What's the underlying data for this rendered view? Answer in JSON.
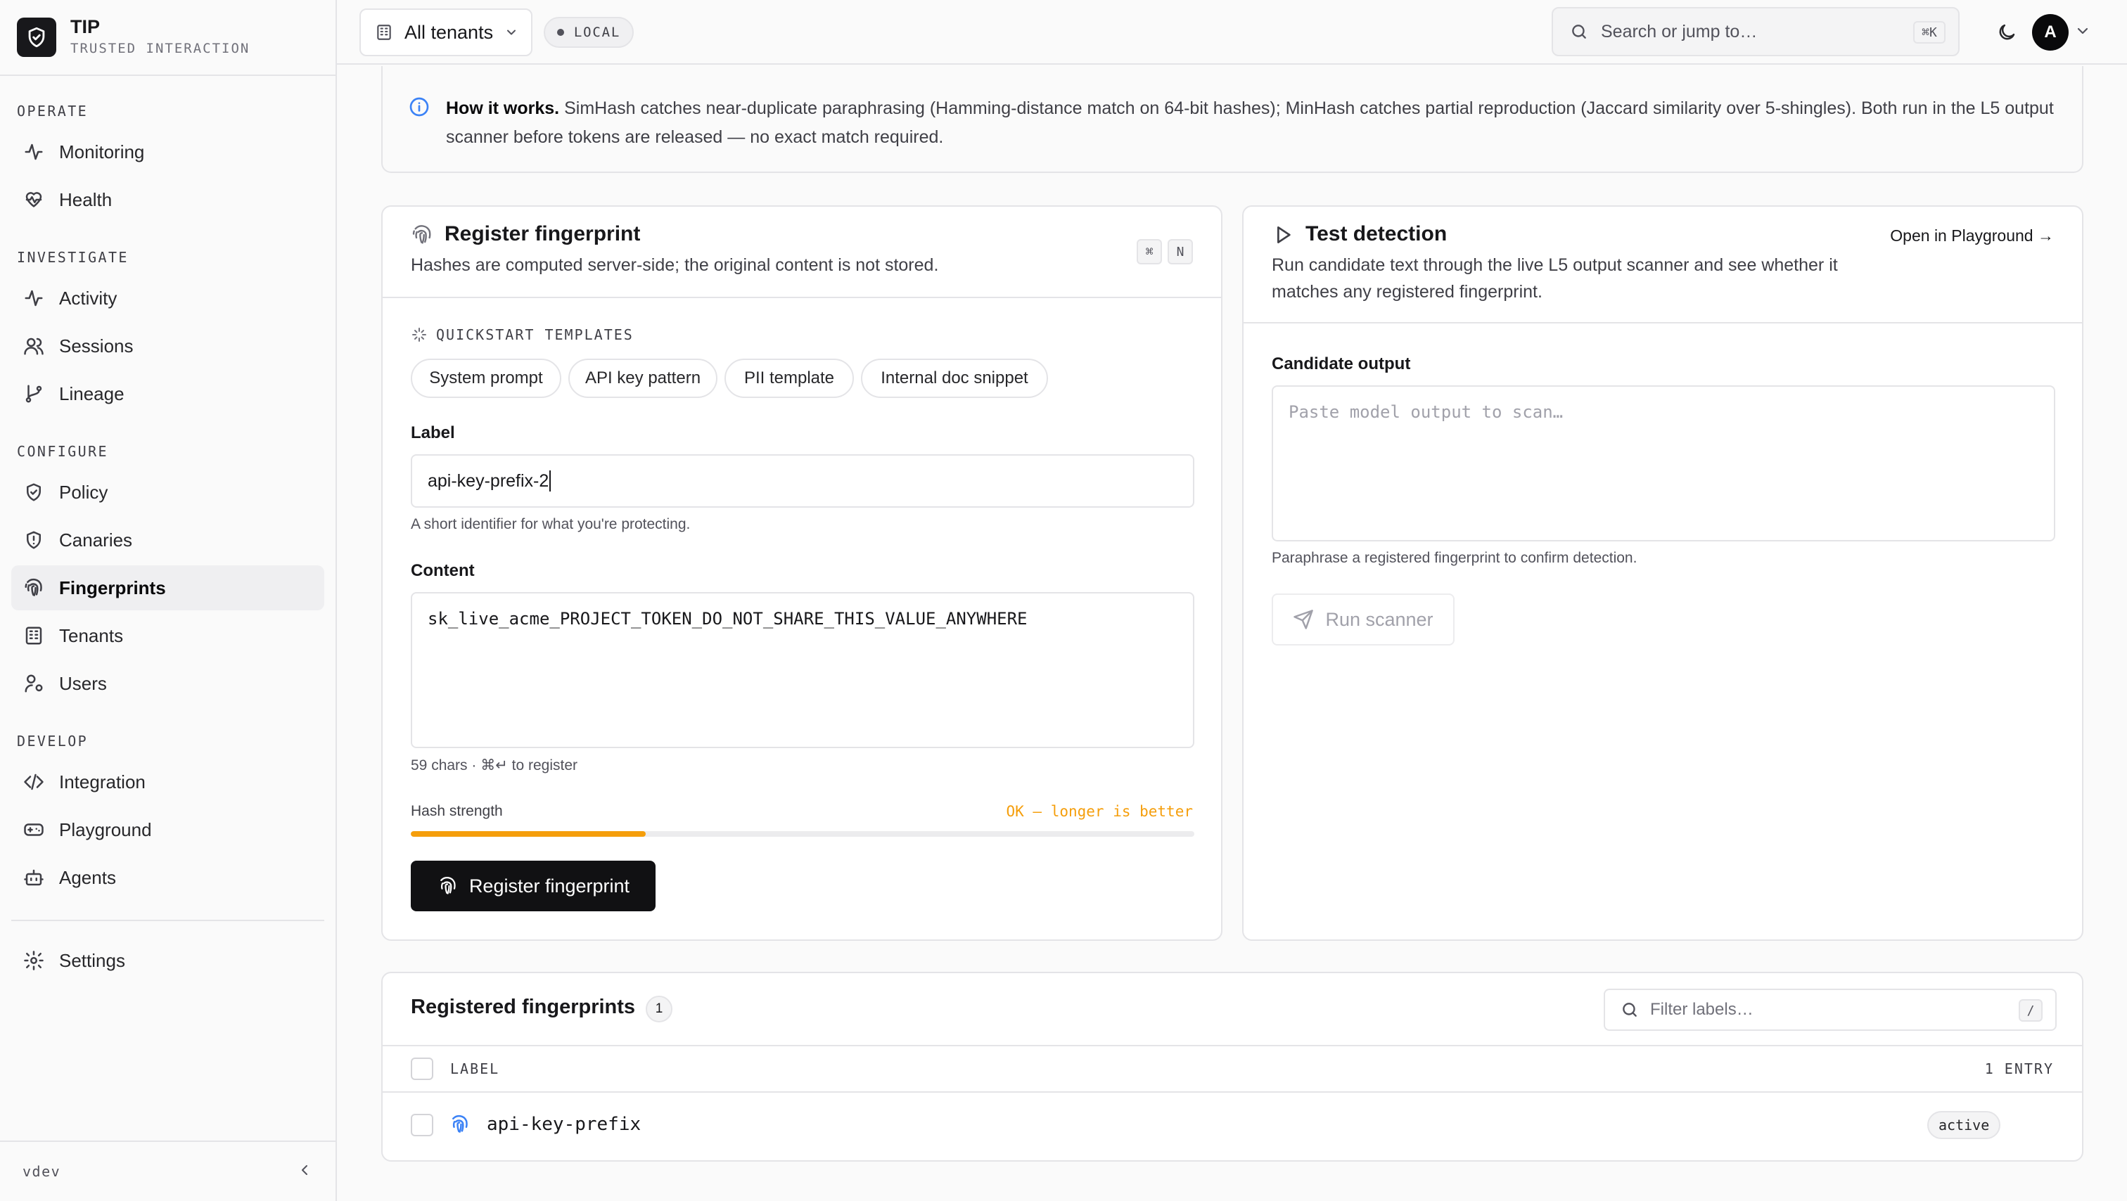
{
  "brand": {
    "title": "TIP",
    "subtitle": "TRUSTED INTERACTION"
  },
  "sidebar": {
    "sections": [
      {
        "label": "OPERATE",
        "items": [
          {
            "label": "Monitoring",
            "icon": "activity-icon"
          },
          {
            "label": "Health",
            "icon": "heart-pulse-icon"
          }
        ]
      },
      {
        "label": "INVESTIGATE",
        "items": [
          {
            "label": "Activity",
            "icon": "activity-icon"
          },
          {
            "label": "Sessions",
            "icon": "users-icon"
          },
          {
            "label": "Lineage",
            "icon": "git-branch-icon"
          }
        ]
      },
      {
        "label": "CONFIGURE",
        "items": [
          {
            "label": "Policy",
            "icon": "shield-check-icon"
          },
          {
            "label": "Canaries",
            "icon": "shield-alert-icon"
          },
          {
            "label": "Fingerprints",
            "icon": "fingerprint-icon",
            "active": true
          },
          {
            "label": "Tenants",
            "icon": "building-icon"
          },
          {
            "label": "Users",
            "icon": "user-cog-icon"
          }
        ]
      },
      {
        "label": "DEVELOP",
        "items": [
          {
            "label": "Integration",
            "icon": "code-icon"
          },
          {
            "label": "Playground",
            "icon": "gamepad-icon"
          },
          {
            "label": "Agents",
            "icon": "bot-icon"
          }
        ]
      }
    ],
    "settings_label": "Settings",
    "version": "vdev"
  },
  "topbar": {
    "tenant_selector": "All tenants",
    "env_badge": "LOCAL",
    "search_placeholder": "Search or jump to…",
    "search_shortcut": "⌘K",
    "avatar_initial": "A"
  },
  "info": {
    "heading": "How it works.",
    "body": "SimHash catches near-duplicate paraphrasing (Hamming-distance match on 64-bit hashes); MinHash catches partial reproduction (Jaccard similarity over 5-shingles). Both run in the L5 output scanner before tokens are released — no exact match required."
  },
  "register": {
    "title": "Register fingerprint",
    "description": "Hashes are computed server-side; the original content is not stored.",
    "shortcut_keys": [
      "⌘",
      "N"
    ],
    "templates_heading": "QUICKSTART TEMPLATES",
    "templates": [
      "System prompt",
      "API key pattern",
      "PII template",
      "Internal doc snippet"
    ],
    "label_field": {
      "label": "Label",
      "value": "api-key-prefix-2",
      "hint": "A short identifier for what you're protecting."
    },
    "content_field": {
      "label": "Content",
      "value": "sk_live_acme_PROJECT_TOKEN_DO_NOT_SHARE_THIS_VALUE_ANYWHERE",
      "hint": "59 chars · ⌘↵ to register"
    },
    "hash_strength": {
      "label": "Hash strength",
      "status": "OK — longer is better",
      "fraction": 0.3,
      "color": "#f59e0b"
    },
    "submit_label": "Register fingerprint"
  },
  "test": {
    "title": "Test detection",
    "description": "Run candidate text through the live L5 output scanner and see whether it matches any registered fingerprint.",
    "open_link": "Open in Playground →",
    "candidate_label": "Candidate output",
    "candidate_placeholder": "Paste model output to scan…",
    "candidate_hint": "Paraphrase a registered fingerprint to confirm detection.",
    "run_label": "Run scanner"
  },
  "registered": {
    "title": "Registered fingerprints",
    "count": "1",
    "filter_placeholder": "Filter labels…",
    "filter_shortcut": "/",
    "column_label": "LABEL",
    "entry_count": "1 ENTRY",
    "rows": [
      {
        "label": "api-key-prefix",
        "status": "active"
      }
    ]
  },
  "colors": {
    "accent_blue": "#3b82f6",
    "warning": "#f59e0b",
    "dark": "#111113"
  }
}
